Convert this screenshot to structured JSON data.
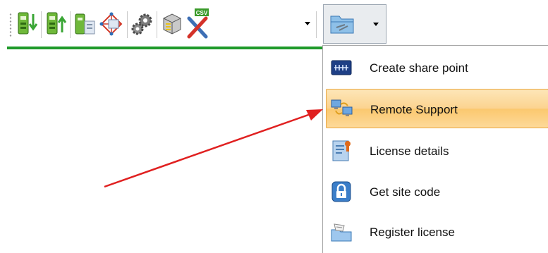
{
  "toolbar": {
    "csv_badge": "CSV",
    "buttons": [
      {
        "icon": "download-instrument-icon"
      },
      {
        "icon": "upload-instrument-icon"
      },
      {
        "icon": "copy-instrument-icon"
      },
      {
        "icon": "traverse-network-icon"
      },
      {
        "icon": "settings-gears-icon"
      },
      {
        "icon": "storage-database-icon"
      },
      {
        "icon": "csv-export-icon"
      },
      {
        "icon": "tools-folder-icon"
      }
    ],
    "accent_color": "#1f9a2a"
  },
  "menu": {
    "items": [
      {
        "label": "Create share point",
        "icon": "share-point-icon",
        "highlighted": false
      },
      {
        "label": "Remote Support",
        "icon": "remote-support-icon",
        "highlighted": true
      },
      {
        "label": "License details",
        "icon": "license-details-icon",
        "highlighted": false
      },
      {
        "label": "Get site code",
        "icon": "lock-icon",
        "highlighted": false
      },
      {
        "label": "Register license",
        "icon": "register-license-icon",
        "highlighted": false
      }
    ],
    "highlight_color": "#fcd38f"
  },
  "annotation": {
    "arrow_color": "#e02020"
  }
}
